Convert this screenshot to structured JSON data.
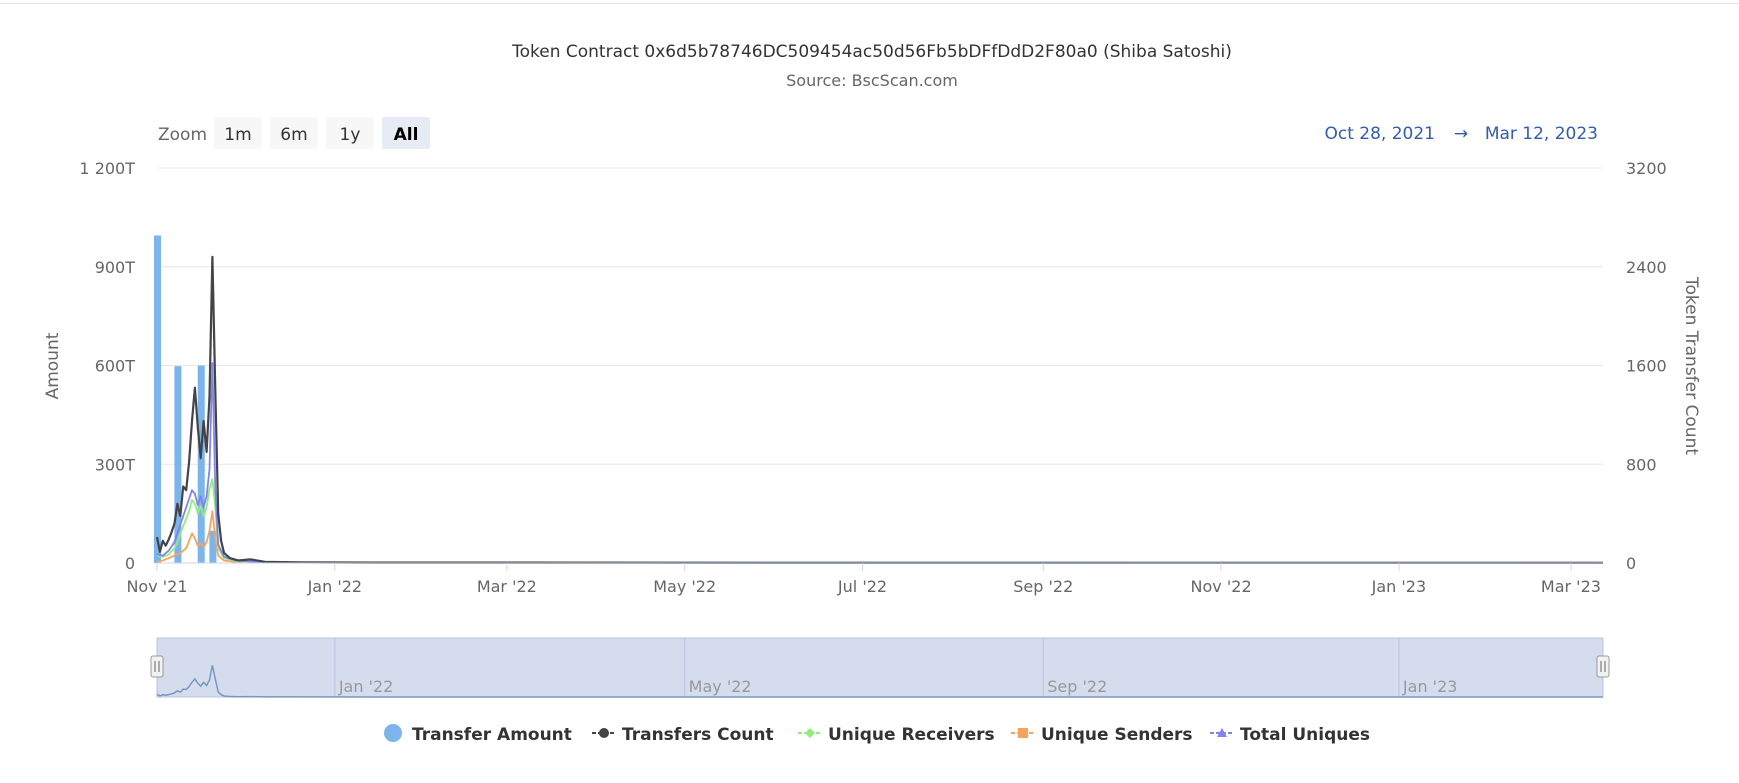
{
  "chart_data": {
    "type": "bar+line",
    "title": "Token Contract 0x6d5b78746DC509454ac50d56Fb5bDFfDdD2F80a0 (Shiba Satoshi)",
    "subtitle": "Source: BscScan.com",
    "zoom": {
      "label": "Zoom",
      "buttons": [
        "1m",
        "6m",
        "1y",
        "All"
      ],
      "selected": "All"
    },
    "range": {
      "from": "Oct 28, 2021",
      "arrow": "→",
      "to": "Mar 12, 2023"
    },
    "y_left": {
      "label": "Amount",
      "ylim": [
        0,
        1200
      ],
      "unit": "T",
      "ticks": [
        "0",
        "300T",
        "600T",
        "900T",
        "1 200T"
      ]
    },
    "y_right": {
      "label": "Token Transfer Count",
      "ylim": [
        0,
        3200
      ],
      "ticks": [
        "0",
        "800",
        "1600",
        "2400",
        "3200"
      ]
    },
    "x_start": "2021-11-01",
    "x_end": "2023-03-12",
    "x_ticks": [
      {
        "date": "2021-11-01",
        "label": "Nov '21"
      },
      {
        "date": "2022-01-01",
        "label": "Jan '22"
      },
      {
        "date": "2022-03-01",
        "label": "Mar '22"
      },
      {
        "date": "2022-05-01",
        "label": "May '22"
      },
      {
        "date": "2022-07-01",
        "label": "Jul '22"
      },
      {
        "date": "2022-09-01",
        "label": "Sep '22"
      },
      {
        "date": "2022-11-01",
        "label": "Nov '22"
      },
      {
        "date": "2023-01-01",
        "label": "Jan '23"
      },
      {
        "date": "2023-03-01",
        "label": "Mar '23"
      }
    ],
    "navigator_ticks": [
      {
        "date": "2022-01-01",
        "label": "Jan '22"
      },
      {
        "date": "2022-05-01",
        "label": "May '22"
      },
      {
        "date": "2022-09-01",
        "label": "Sep '22"
      },
      {
        "date": "2023-01-01",
        "label": "Jan '23"
      }
    ],
    "bar_series": {
      "name": "Transfer Amount",
      "color": "#7cb5ec",
      "points": [
        {
          "date": "2021-11-01",
          "value": 995
        },
        {
          "date": "2021-11-08",
          "value": 598
        },
        {
          "date": "2021-11-16",
          "value": 600
        },
        {
          "date": "2021-11-20",
          "value": 98
        }
      ]
    },
    "line_series": [
      {
        "name": "Transfers Count",
        "color": "#434348",
        "points": [
          [
            "2021-11-01",
            210
          ],
          [
            "2021-11-02",
            90
          ],
          [
            "2021-11-03",
            180
          ],
          [
            "2021-11-04",
            140
          ],
          [
            "2021-11-05",
            190
          ],
          [
            "2021-11-06",
            250
          ],
          [
            "2021-11-07",
            320
          ],
          [
            "2021-11-08",
            480
          ],
          [
            "2021-11-09",
            380
          ],
          [
            "2021-11-10",
            620
          ],
          [
            "2021-11-11",
            590
          ],
          [
            "2021-11-12",
            820
          ],
          [
            "2021-11-13",
            1150
          ],
          [
            "2021-11-14",
            1420
          ],
          [
            "2021-11-15",
            1100
          ],
          [
            "2021-11-16",
            850
          ],
          [
            "2021-11-17",
            1150
          ],
          [
            "2021-11-18",
            900
          ],
          [
            "2021-11-19",
            1350
          ],
          [
            "2021-11-20",
            2480
          ],
          [
            "2021-11-21",
            1400
          ],
          [
            "2021-11-22",
            400
          ],
          [
            "2021-11-23",
            180
          ],
          [
            "2021-11-24",
            80
          ],
          [
            "2021-11-26",
            40
          ],
          [
            "2021-11-29",
            20
          ],
          [
            "2021-12-03",
            30
          ],
          [
            "2021-12-08",
            10
          ],
          [
            "2021-12-20",
            5
          ],
          [
            "2022-01-15",
            3
          ],
          [
            "2022-03-10",
            3
          ],
          [
            "2022-06-01",
            2
          ],
          [
            "2023-03-12",
            2
          ]
        ]
      },
      {
        "name": "Unique Receivers",
        "color": "#90ed7d",
        "points": [
          [
            "2021-11-01",
            60
          ],
          [
            "2021-11-03",
            50
          ],
          [
            "2021-11-05",
            70
          ],
          [
            "2021-11-07",
            120
          ],
          [
            "2021-11-08",
            170
          ],
          [
            "2021-11-10",
            300
          ],
          [
            "2021-11-12",
            420
          ],
          [
            "2021-11-13",
            510
          ],
          [
            "2021-11-14",
            480
          ],
          [
            "2021-11-15",
            400
          ],
          [
            "2021-11-16",
            460
          ],
          [
            "2021-11-17",
            380
          ],
          [
            "2021-11-18",
            450
          ],
          [
            "2021-11-19",
            600
          ],
          [
            "2021-11-20",
            680
          ],
          [
            "2021-11-21",
            450
          ],
          [
            "2021-11-22",
            120
          ],
          [
            "2021-11-24",
            40
          ],
          [
            "2021-11-28",
            15
          ],
          [
            "2021-12-08",
            5
          ],
          [
            "2022-01-15",
            2
          ],
          [
            "2023-03-12",
            1
          ]
        ]
      },
      {
        "name": "Unique Senders",
        "color": "#f7a35c",
        "points": [
          [
            "2021-11-01",
            10
          ],
          [
            "2021-11-03",
            20
          ],
          [
            "2021-11-05",
            40
          ],
          [
            "2021-11-07",
            60
          ],
          [
            "2021-11-09",
            80
          ],
          [
            "2021-11-11",
            120
          ],
          [
            "2021-11-13",
            240
          ],
          [
            "2021-11-14",
            200
          ],
          [
            "2021-11-15",
            140
          ],
          [
            "2021-11-16",
            160
          ],
          [
            "2021-11-17",
            130
          ],
          [
            "2021-11-18",
            170
          ],
          [
            "2021-11-19",
            260
          ],
          [
            "2021-11-20",
            420
          ],
          [
            "2021-11-21",
            200
          ],
          [
            "2021-11-22",
            60
          ],
          [
            "2021-11-24",
            20
          ],
          [
            "2021-11-28",
            8
          ],
          [
            "2021-12-08",
            3
          ],
          [
            "2022-01-15",
            1
          ],
          [
            "2023-03-12",
            1
          ]
        ]
      },
      {
        "name": "Total Uniques",
        "color": "#8085e9",
        "points": [
          [
            "2021-11-01",
            70
          ],
          [
            "2021-11-03",
            60
          ],
          [
            "2021-11-05",
            100
          ],
          [
            "2021-11-07",
            170
          ],
          [
            "2021-11-08",
            240
          ],
          [
            "2021-11-10",
            380
          ],
          [
            "2021-11-12",
            520
          ],
          [
            "2021-11-13",
            590
          ],
          [
            "2021-11-14",
            560
          ],
          [
            "2021-11-15",
            470
          ],
          [
            "2021-11-16",
            540
          ],
          [
            "2021-11-17",
            450
          ],
          [
            "2021-11-18",
            540
          ],
          [
            "2021-11-19",
            760
          ],
          [
            "2021-11-20",
            1620
          ],
          [
            "2021-11-21",
            600
          ],
          [
            "2021-11-22",
            150
          ],
          [
            "2021-11-24",
            50
          ],
          [
            "2021-11-28",
            20
          ],
          [
            "2021-12-08",
            6
          ],
          [
            "2022-01-15",
            3
          ],
          [
            "2023-03-12",
            2
          ]
        ]
      }
    ],
    "legend": [
      {
        "name": "Transfer Amount",
        "marker": "circle",
        "color": "#7cb5ec"
      },
      {
        "name": "Transfers Count",
        "marker": "circle-line",
        "color": "#434348"
      },
      {
        "name": "Unique Receivers",
        "marker": "diamond-line",
        "color": "#90ed7d"
      },
      {
        "name": "Unique Senders",
        "marker": "square-line",
        "color": "#f7a35c"
      },
      {
        "name": "Total Uniques",
        "marker": "triangle-line",
        "color": "#8085e9"
      }
    ],
    "legend_placement": "bottom",
    "grid": true
  }
}
